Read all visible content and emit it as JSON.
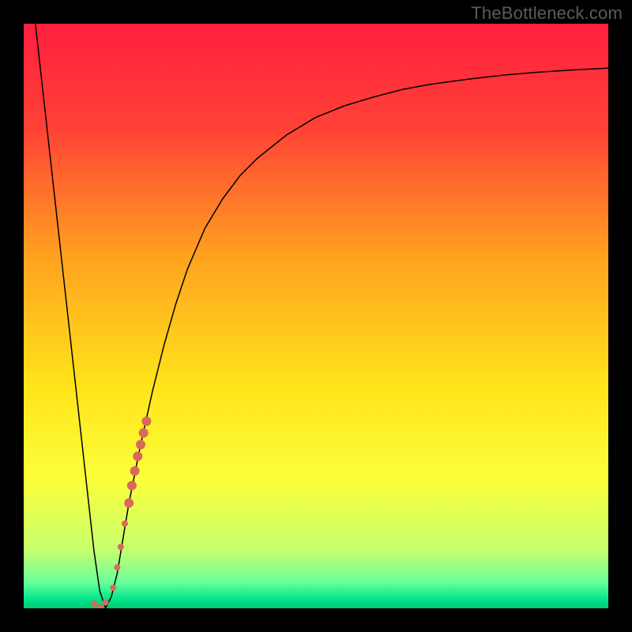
{
  "watermark": "TheBottleneck.com",
  "chart_data": {
    "type": "line",
    "title": "",
    "xlabel": "",
    "ylabel": "",
    "xlim": [
      0,
      100
    ],
    "ylim": [
      0,
      100
    ],
    "background_gradient": {
      "stops": [
        {
          "offset": 0.0,
          "color": "#ff1f3f"
        },
        {
          "offset": 0.18,
          "color": "#ff4236"
        },
        {
          "offset": 0.4,
          "color": "#ffa21f"
        },
        {
          "offset": 0.62,
          "color": "#ffe41a"
        },
        {
          "offset": 0.78,
          "color": "#fbff3a"
        },
        {
          "offset": 0.9,
          "color": "#c6ff6e"
        },
        {
          "offset": 0.955,
          "color": "#6aff9a"
        },
        {
          "offset": 0.985,
          "color": "#00e58a"
        },
        {
          "offset": 1.0,
          "color": "#00c96f"
        }
      ]
    },
    "series": [
      {
        "name": "bottleneck-curve",
        "stroke": "#000000",
        "stroke_width": 1.5,
        "x": [
          2,
          4,
          6,
          8,
          10,
          11,
          12,
          13,
          14,
          15,
          16,
          17,
          18,
          20,
          22,
          24,
          26,
          28,
          31,
          34,
          37,
          40,
          45,
          50,
          55,
          60,
          65,
          70,
          76,
          82,
          88,
          94,
          100
        ],
        "y": [
          100,
          82,
          64,
          46,
          28,
          19,
          10,
          3,
          0,
          2,
          6,
          12,
          18,
          28,
          37,
          45,
          52,
          58,
          65,
          70,
          74,
          77,
          81,
          84,
          86,
          87.5,
          88.8,
          89.7,
          90.5,
          91.2,
          91.7,
          92.1,
          92.4
        ]
      }
    ],
    "markers": {
      "name": "highlighted-segment",
      "color": "#d86a5c",
      "radius_main": 6,
      "radius_small": 4,
      "points_main": [
        {
          "x": 21.0,
          "y": 32.0
        },
        {
          "x": 20.5,
          "y": 30.0
        },
        {
          "x": 20.0,
          "y": 28.0
        },
        {
          "x": 19.5,
          "y": 26.0
        },
        {
          "x": 19.0,
          "y": 23.5
        },
        {
          "x": 18.5,
          "y": 21.0
        },
        {
          "x": 18.0,
          "y": 18.0
        }
      ],
      "points_small": [
        {
          "x": 17.3,
          "y": 14.5
        },
        {
          "x": 16.6,
          "y": 10.5
        },
        {
          "x": 16.0,
          "y": 7.0
        },
        {
          "x": 15.3,
          "y": 3.5
        },
        {
          "x": 12.0,
          "y": 0.8
        },
        {
          "x": 13.0,
          "y": 0.2
        },
        {
          "x": 14.0,
          "y": 1.0
        }
      ]
    }
  }
}
